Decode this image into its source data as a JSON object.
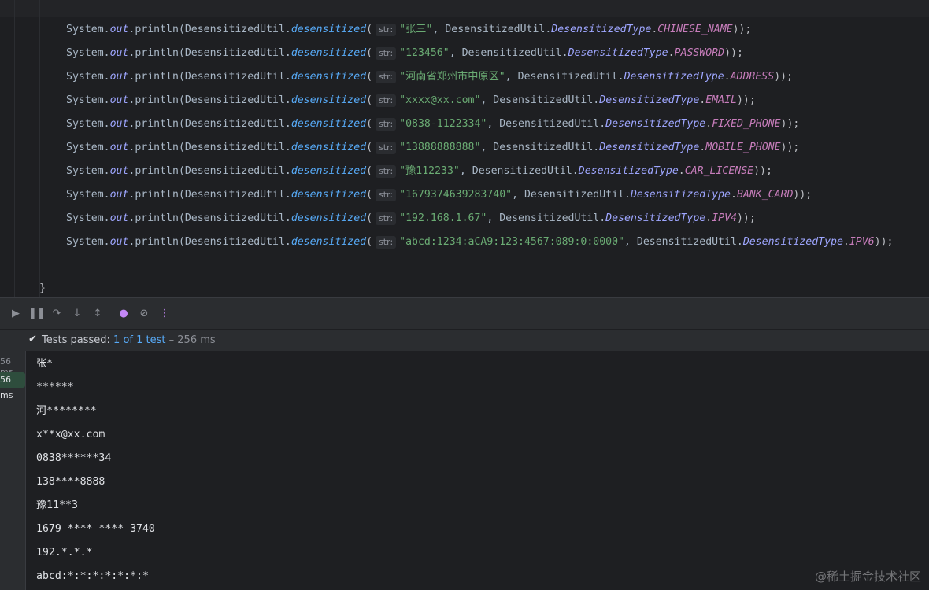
{
  "code": {
    "lines": [
      {
        "a": "System.",
        "b": "out",
        "c": ".println(DesensitizedUtil.",
        "d": "desensitized",
        "e": "(",
        "hint": "str:",
        "f": "\"张三\"",
        "g": ", DesensitizedUtil.",
        "h": "DesensitizedType",
        "i": ".",
        "j": "CHINESE_NAME",
        "k": "));"
      },
      {
        "a": "System.",
        "b": "out",
        "c": ".println(DesensitizedUtil.",
        "d": "desensitized",
        "e": "(",
        "hint": "str:",
        "f": "\"123456\"",
        "g": ", DesensitizedUtil.",
        "h": "DesensitizedType",
        "i": ".",
        "j": "PASSWORD",
        "k": "));"
      },
      {
        "a": "System.",
        "b": "out",
        "c": ".println(DesensitizedUtil.",
        "d": "desensitized",
        "e": "(",
        "hint": "str:",
        "f": "\"河南省郑州市中原区\"",
        "g": ", DesensitizedUtil.",
        "h": "DesensitizedType",
        "i": ".",
        "j": "ADDRESS",
        "k": "));"
      },
      {
        "a": "System.",
        "b": "out",
        "c": ".println(DesensitizedUtil.",
        "d": "desensitized",
        "e": "(",
        "hint": "str:",
        "f": "\"xxxx@xx.com\"",
        "g": ", DesensitizedUtil.",
        "h": "DesensitizedType",
        "i": ".",
        "j": "EMAIL",
        "k": "));"
      },
      {
        "a": "System.",
        "b": "out",
        "c": ".println(DesensitizedUtil.",
        "d": "desensitized",
        "e": "(",
        "hint": "str:",
        "f": "\"0838-1122334\"",
        "g": ", DesensitizedUtil.",
        "h": "DesensitizedType",
        "i": ".",
        "j": "FIXED_PHONE",
        "k": "));"
      },
      {
        "a": "System.",
        "b": "out",
        "c": ".println(DesensitizedUtil.",
        "d": "desensitized",
        "e": "(",
        "hint": "str:",
        "f": "\"13888888888\"",
        "g": ", DesensitizedUtil.",
        "h": "DesensitizedType",
        "i": ".",
        "j": "MOBILE_PHONE",
        "k": "));"
      },
      {
        "a": "System.",
        "b": "out",
        "c": ".println(DesensitizedUtil.",
        "d": "desensitized",
        "e": "(",
        "hint": "str:",
        "f": "\"豫112233\"",
        "g": ", DesensitizedUtil.",
        "h": "DesensitizedType",
        "i": ".",
        "j": "CAR_LICENSE",
        "k": "));"
      },
      {
        "a": "System.",
        "b": "out",
        "c": ".println(DesensitizedUtil.",
        "d": "desensitized",
        "e": "(",
        "hint": "str:",
        "f": "\"1679374639283740\"",
        "g": ", DesensitizedUtil.",
        "h": "DesensitizedType",
        "i": ".",
        "j": "BANK_CARD",
        "k": "));"
      },
      {
        "a": "System.",
        "b": "out",
        "c": ".println(DesensitizedUtil.",
        "d": "desensitized",
        "e": "(",
        "hint": "str:",
        "f": "\"192.168.1.67\"",
        "g": ", DesensitizedUtil.",
        "h": "DesensitizedType",
        "i": ".",
        "j": "IPV4",
        "k": "));"
      },
      {
        "a": "System.",
        "b": "out",
        "c": ".println(DesensitizedUtil.",
        "d": "desensitized",
        "e": "(",
        "hint": "str:",
        "f": "\"abcd:1234:aCA9:123:4567:089:0:0000\"",
        "g": ", DesensitizedUtil.",
        "h": "DesensitizedType",
        "i": ".",
        "j": "IPV6",
        "k": "));"
      }
    ],
    "closing": "}"
  },
  "toolbar": {
    "icons": [
      "rerun-icon",
      "pause-icon",
      "step-over-icon",
      "step-into-icon",
      "step-out-icon",
      "planet-icon",
      "planet-off-icon",
      "more-vertical-icon"
    ]
  },
  "status": {
    "prefix": "Tests passed:",
    "passed": "1",
    "of": "of",
    "total": "1 test",
    "duration": "– 256 ms"
  },
  "tree": {
    "item1": "56 ms",
    "item2": "56 ms"
  },
  "console": {
    "output": [
      "张*",
      "******",
      "河********",
      "x**x@xx.com",
      "0838******34",
      "138****8888",
      "豫11**3",
      "1679 **** **** 3740",
      "192.*.*.*",
      "abcd:*:*:*:*:*:*:*"
    ]
  },
  "watermark": "@稀土掘金技术社区",
  "colors": {
    "background": "#1e1f22",
    "panel": "#2b2d30",
    "string": "#6aab73",
    "constant": "#c77dbb",
    "method": "#57aaf7",
    "static_field": "#9ea6ff",
    "accent": "#c387f5"
  }
}
